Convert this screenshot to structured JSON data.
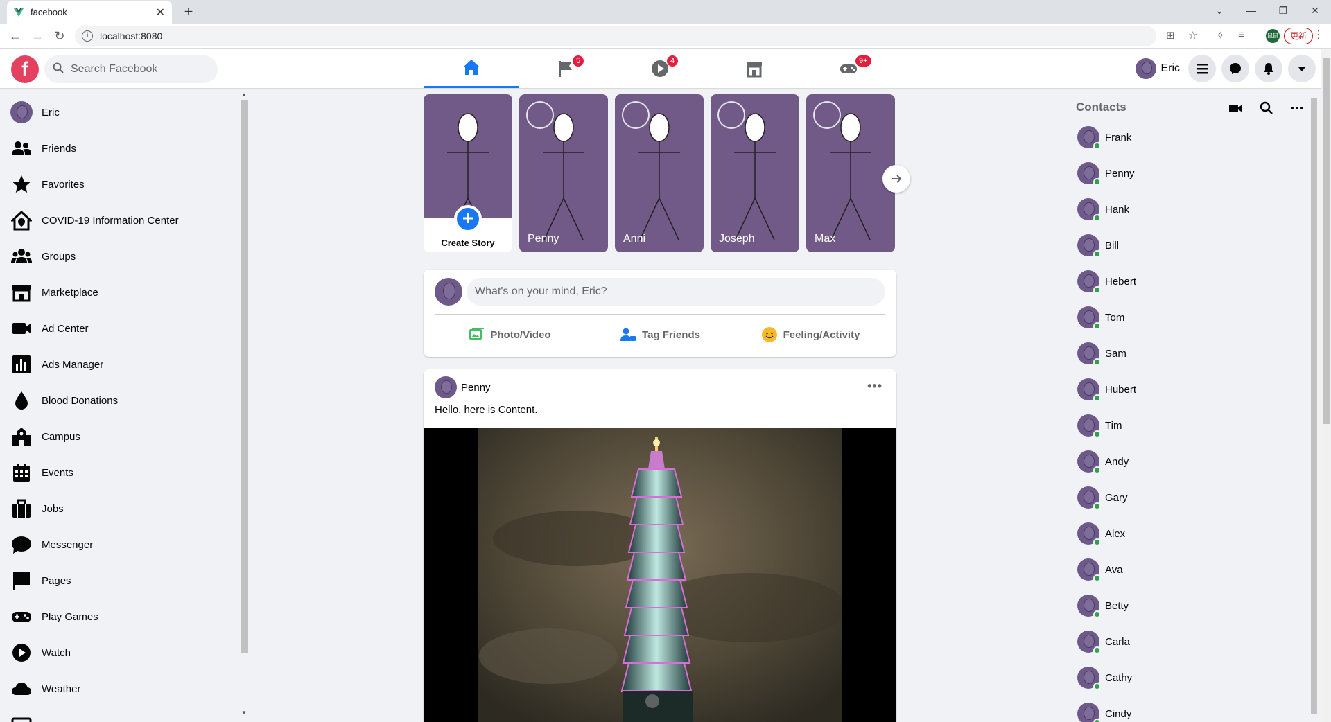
{
  "browser": {
    "tab_title": "facebook",
    "url": "localhost:8080",
    "update_label": "更新",
    "profile_label": "鼠鼠"
  },
  "header": {
    "search_placeholder": "Search Facebook",
    "user_name": "Eric",
    "nav": [
      {
        "name": "home",
        "badge": ""
      },
      {
        "name": "pages",
        "badge": "5"
      },
      {
        "name": "watch",
        "badge": "4"
      },
      {
        "name": "marketplace",
        "badge": ""
      },
      {
        "name": "gaming",
        "badge": "9+"
      }
    ]
  },
  "sidebar": {
    "items": [
      {
        "label": "Eric",
        "icon": "avatar"
      },
      {
        "label": "Friends",
        "icon": "friends-icon"
      },
      {
        "label": "Favorites",
        "icon": "star-icon"
      },
      {
        "label": "COVID-19 Information Center",
        "icon": "covid-home-icon"
      },
      {
        "label": "Groups",
        "icon": "groups-icon"
      },
      {
        "label": "Marketplace",
        "icon": "store-icon"
      },
      {
        "label": "Ad Center",
        "icon": "video-camera-icon"
      },
      {
        "label": "Ads Manager",
        "icon": "bar-chart-icon"
      },
      {
        "label": "Blood Donations",
        "icon": "blood-drop-icon"
      },
      {
        "label": "Campus",
        "icon": "campus-icon"
      },
      {
        "label": "Events",
        "icon": "calendar-icon"
      },
      {
        "label": "Jobs",
        "icon": "briefcase-icon"
      },
      {
        "label": "Messenger",
        "icon": "chat-bubble-icon"
      },
      {
        "label": "Pages",
        "icon": "flag-icon"
      },
      {
        "label": "Play Games",
        "icon": "gamepad-icon"
      },
      {
        "label": "Watch",
        "icon": "play-icon"
      },
      {
        "label": "Weather",
        "icon": "cloud-icon"
      }
    ]
  },
  "stories": {
    "create_label": "Create Story",
    "items": [
      "Penny",
      "Anni",
      "Joseph",
      "Max"
    ]
  },
  "composer": {
    "placeholder": "What's on your mind, Eric?",
    "actions": [
      "Photo/Video",
      "Tag Friends",
      "Feeling/Activity"
    ]
  },
  "post": {
    "author": "Penny",
    "text": "Hello, here is Content.",
    "more": "•••"
  },
  "contacts": {
    "title": "Contacts",
    "items": [
      "Frank",
      "Penny",
      "Hank",
      "Bill",
      "Hebert",
      "Tom",
      "Sam",
      "Hubert",
      "Tim",
      "Andy",
      "Gary",
      "Alex",
      "Ava",
      "Betty",
      "Carla",
      "Cathy",
      "Cindy"
    ]
  },
  "colors": {
    "accent": "#1877f2",
    "badge": "#e41e3f",
    "story_bg": "#725a88",
    "online": "#31a24c"
  }
}
